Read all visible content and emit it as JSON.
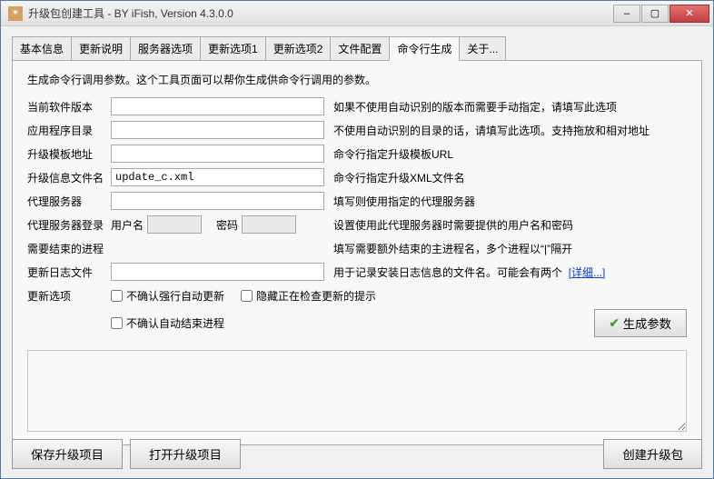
{
  "window": {
    "title": "升级包创建工具 - BY iFish, Version 4.3.0.0",
    "minimize": "–",
    "maximize": "▢",
    "close": "✕"
  },
  "tabs": [
    "基本信息",
    "更新说明",
    "服务器选项",
    "更新选项1",
    "更新选项2",
    "文件配置",
    "命令行生成",
    "关于..."
  ],
  "intro": "生成命令行调用参数。这个工具页面可以帮你生成供命令行调用的参数。",
  "rows": {
    "version": {
      "label": "当前软件版本",
      "value": "",
      "desc": "如果不使用自动识别的版本而需要手动指定，请填写此选项"
    },
    "appdir": {
      "label": "应用程序目录",
      "value": "",
      "desc": "不使用自动识别的目录的话，请填写此选项。支持拖放和相对地址"
    },
    "template": {
      "label": "升级模板地址",
      "value": "",
      "desc": "命令行指定升级模板URL"
    },
    "xmlfile": {
      "label": "升级信息文件名",
      "value": "update_c.xml",
      "desc": "命令行指定升级XML文件名"
    },
    "proxy": {
      "label": "代理服务器",
      "value": "",
      "desc": "填写则使用指定的代理服务器"
    },
    "proxylogin": {
      "label": "代理服务器登录",
      "user_lbl": "用户名",
      "pass_lbl": "密码",
      "desc": "设置使用此代理服务器时需要提供的用户名和密码"
    },
    "termproc": {
      "label": "需要结束的进程",
      "value": "",
      "desc": "填写需要额外结束的主进程名，多个进程以“|”隔开"
    },
    "logfile": {
      "label": "更新日志文件",
      "value": "",
      "desc": "用于记录安装日志信息的文件名。可能会有两个",
      "link": "[详细...]"
    },
    "options": {
      "label": "更新选项",
      "cb1": "不确认强行自动更新",
      "cb2": "隐藏正在检查更新的提示",
      "cb3": "不确认自动结束进程"
    }
  },
  "buttons": {
    "generate": "生成参数",
    "save": "保存升级项目",
    "open": "打开升级项目",
    "create": "创建升级包"
  }
}
